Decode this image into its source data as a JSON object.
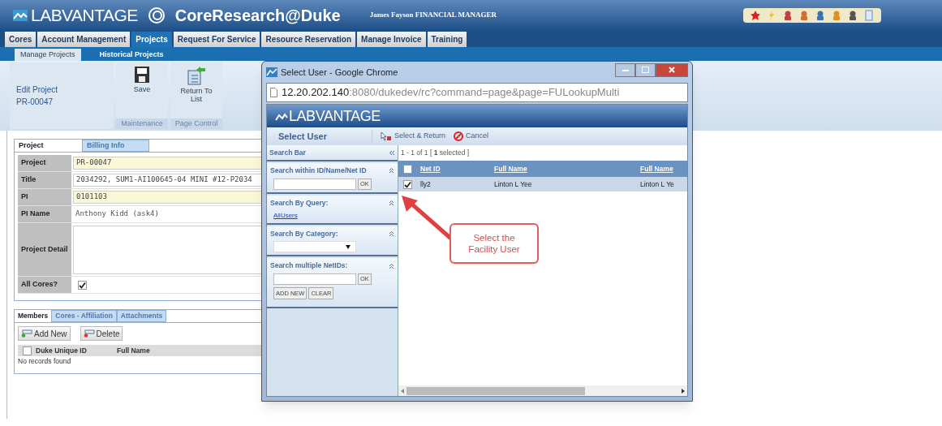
{
  "header": {
    "brand": "LABVANTAGE",
    "product": "CoreResearch@Duke",
    "user": "James Fayson FINANCIAL MANAGER"
  },
  "nav_tabs": [
    {
      "label": "Cores",
      "selected": false
    },
    {
      "label": "Account Management",
      "selected": false
    },
    {
      "label": "Projects",
      "selected": true
    },
    {
      "label": "Request For Service",
      "selected": false
    },
    {
      "label": "Resource Reservation",
      "selected": false
    },
    {
      "label": "Manage Invoice",
      "selected": false
    },
    {
      "label": "Training",
      "selected": false
    }
  ],
  "sub_tabs": [
    {
      "label": "Manage Projects",
      "selected": true
    },
    {
      "label": "Historical Projects",
      "selected": false
    }
  ],
  "toolbar": {
    "title": "Edit Project",
    "record": "PR-00047",
    "groups": [
      {
        "label": "Maintenance",
        "buttons": [
          {
            "label": "Save",
            "kind": "save"
          }
        ]
      },
      {
        "label": "Page Control",
        "buttons": [
          {
            "label": "Return To List",
            "kind": "return"
          }
        ]
      }
    ]
  },
  "form_tabs": [
    {
      "label": "Project",
      "selected": true
    },
    {
      "label": "Billing Info",
      "selected": false
    }
  ],
  "fields": [
    {
      "label": "Project",
      "kind": "required",
      "value": "PR-00047"
    },
    {
      "label": "Title",
      "kind": "input",
      "value": "2034292, SUM1-AI100645-04 MINI #12-P2034"
    },
    {
      "label": "PI",
      "kind": "required",
      "value": "0101103"
    },
    {
      "label": "PI Name",
      "kind": "readonly",
      "value": "Anthony Kidd (ask4)"
    },
    {
      "label": "Project Detail",
      "kind": "textarea"
    },
    {
      "label": "All Cores?",
      "kind": "checkbox",
      "checked": true
    }
  ],
  "member_tabs": [
    {
      "label": "Members",
      "selected": true
    },
    {
      "label": "Cores - Affiliation",
      "selected": false
    },
    {
      "label": "Attachments",
      "selected": false
    }
  ],
  "member_buttons": [
    {
      "label": "Add New",
      "kind": "add"
    },
    {
      "label": "Delete",
      "kind": "delete"
    }
  ],
  "members_table": {
    "all_checked": false,
    "columns": [
      "Duke Unique ID",
      "Full Name"
    ],
    "empty": "No records found"
  },
  "popup": {
    "title": "Select User - Google Chrome",
    "url_host": "12.20.202.140",
    "url_rest": ":8080/dukedev/rc?command=page&page=FULookupMulti",
    "brand": "LABVANTAGE",
    "page_title": "Select User",
    "actions": [
      {
        "label": "Select & Return",
        "kind": "select"
      },
      {
        "label": "Cancel",
        "kind": "cancel"
      }
    ],
    "search_bar": "Search Bar",
    "sections": [
      {
        "title": "Search within ID/Name/Net ID",
        "kind": "text",
        "button": "OK"
      },
      {
        "title": "Search By Query:",
        "kind": "link",
        "link": "AllUsers"
      },
      {
        "title": "Search By Category:",
        "kind": "select"
      },
      {
        "title": "Search multiple NetIDs:",
        "kind": "multi",
        "button": "OK",
        "extra_buttons": [
          "ADD NEW",
          "CLEAR"
        ]
      }
    ],
    "summary": "1 - 1 of 1 [ **1** selected ]",
    "all_checked": false,
    "columns": [
      "Net ID",
      "Full Name",
      "Full Name"
    ],
    "rows": [
      {
        "checked": true,
        "selected": true,
        "cells": [
          "lly2",
          "Linton L Yee",
          "Linton L Ye"
        ]
      }
    ],
    "callout": "Select the Facility User"
  }
}
